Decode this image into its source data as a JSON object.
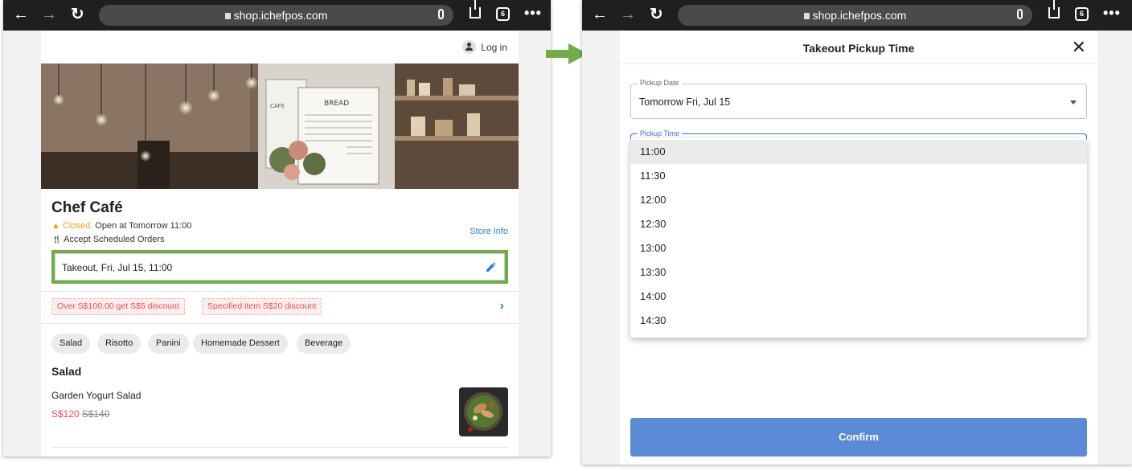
{
  "browser": {
    "url": "shop.ichefpos.com",
    "tab_count": "6",
    "more": "•••"
  },
  "left": {
    "login_label": "Log in",
    "store_name": "Chef Café",
    "closed_label": "Closed.",
    "open_text": " Open at Tomorrow 11:00",
    "scheduled_text": "Accept Scheduled Orders",
    "store_info_link": "Store Info",
    "takeout_value": "Takeout, Fri, Jul 15, 11:00",
    "promos": [
      "Over S$100.00 get S$5 discount",
      "Specified item S$20 discount"
    ],
    "categories": [
      "Salad",
      "Risotto",
      "Panini",
      "Homemade Dessert",
      "Beverage"
    ],
    "section_title": "Salad",
    "item": {
      "name": "Garden Yogurt Salad",
      "price": "S$120",
      "old_price": "S$140"
    },
    "hero_sign_text": "BREAD",
    "hero_cafe_text": "CAFE"
  },
  "right": {
    "title": "Takeout Pickup Time",
    "pickup_date_label": "Pickup Date",
    "pickup_date_value": "Tomorrow Fri, Jul 15",
    "pickup_time_label": "Pickup Time",
    "time_options": [
      "11:00",
      "11:30",
      "12:00",
      "12:30",
      "13:00",
      "13:30",
      "14:00",
      "14:30"
    ],
    "selected_time": "11:00",
    "confirm_label": "Confirm"
  },
  "colors": {
    "highlight_box": "#70ad47",
    "arrow": "#70ad47",
    "link": "#2a7fd4",
    "confirm_bg": "#5b8ad6",
    "closed": "#f0a010",
    "price": "#e84c4c"
  }
}
